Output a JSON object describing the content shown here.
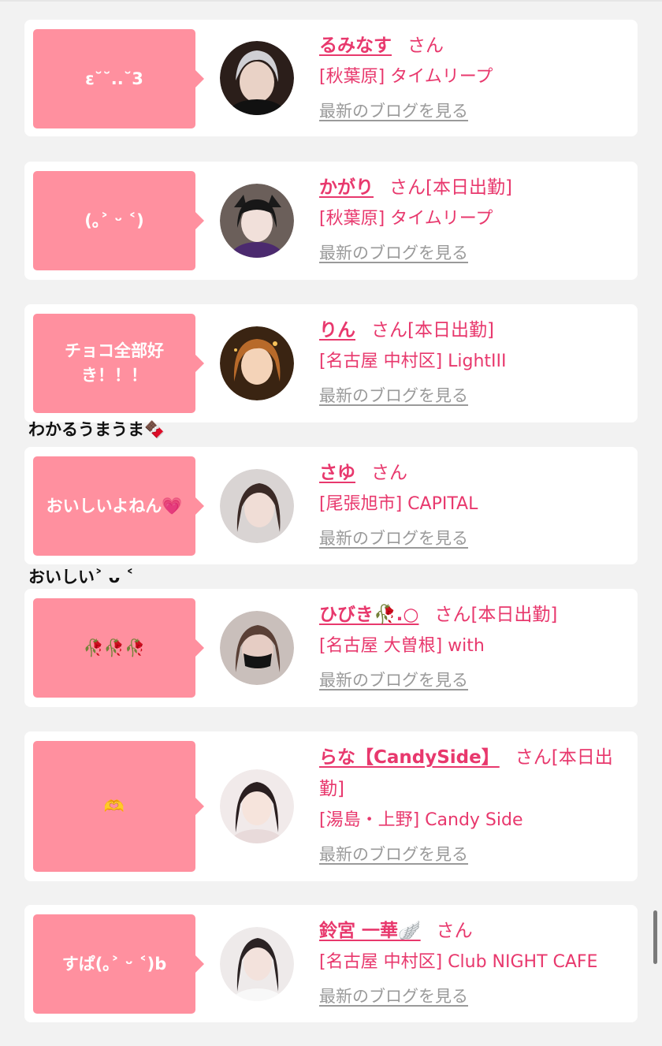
{
  "colors": {
    "accent": "#e8386d",
    "bubble": "#ff909f",
    "link_gray": "#9a9a9a"
  },
  "cards": [
    {
      "bubble": "ε˘˘..˘3",
      "name": "るみなす",
      "suffix": "さん",
      "shop": "[秋葉原] タイムリープ",
      "blog_link": "最新のブログを見る"
    },
    {
      "bubble": "(｡˃ ᵕ ˂)",
      "name": "かがり",
      "suffix": "さん[本日出勤]",
      "shop": "[秋葉原] タイムリープ",
      "blog_link": "最新のブログを見る"
    },
    {
      "bubble": "チョコ全部好き！！！",
      "name": "りん",
      "suffix": "さん[本日出勤]",
      "shop": "[名古屋 中村区] LightIII",
      "blog_link": "最新のブログを見る"
    },
    {
      "bubble": "おいしいよねん💗",
      "name": "さゆ",
      "suffix": "さん",
      "shop": "[尾張旭市] CAPITAL",
      "blog_link": "最新のブログを見る"
    },
    {
      "bubble": "🥀🥀🥀",
      "name": "ひびき🥀.○",
      "suffix": "さん[本日出勤]",
      "shop": "[名古屋 大曽根] with",
      "blog_link": "最新のブログを見る"
    },
    {
      "bubble": "🫶",
      "name": "らな【CandySide】",
      "suffix": "さん[本日出勤]",
      "shop": "[湯島・上野] Candy Side",
      "blog_link": "最新のブログを見る"
    },
    {
      "bubble": "すぱ(｡˃ ᵕ ˂)b",
      "name": "鈴宮 一華🪽",
      "suffix": "さん",
      "shop": "[名古屋 中村区] Club NIGHT CAFE",
      "blog_link": "最新のブログを見る"
    }
  ],
  "overflow_texts": {
    "after_card_3": "わかるうまうま🍫",
    "after_card_4": "おいしい˃ ᴗ ˂"
  }
}
